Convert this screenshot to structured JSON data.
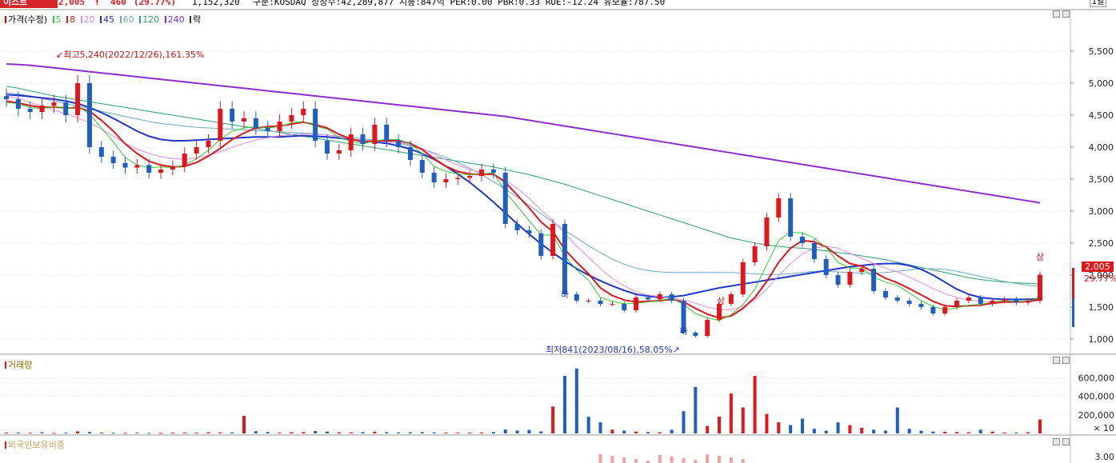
{
  "header": {
    "stock_name": "이스트",
    "price": "2,005",
    "change_arrow": "↑",
    "change": "460",
    "change_pct": "(29.77%)",
    "volume": "1,152,320",
    "info": "구분:KOSDAQ  상장수:42,289,877  시총:847억  PER:0.00  PBR:0.33  ROE:-12.24  유보율:787.50",
    "period": "1일"
  },
  "legend": {
    "items": [
      {
        "label": "가격(수정)",
        "color": "#cc0000"
      },
      {
        "label": "5",
        "color": "#33cc33"
      },
      {
        "label": "8",
        "color": "#e0161d"
      },
      {
        "label": "20",
        "color": "#e68be6"
      },
      {
        "label": "45",
        "color": "#1f37c8"
      },
      {
        "label": "60",
        "color": "#6fa8c6"
      },
      {
        "label": "120",
        "color": "#2e9e6a"
      },
      {
        "label": "240",
        "color": "#8a2fc9"
      },
      {
        "label": "락",
        "color": "#333333"
      }
    ]
  },
  "annotations": {
    "high": "최고5,240(2022/12/26),161.35%",
    "low": "최저841(2023/08/16),58.05%",
    "limit_up": "상",
    "limit_down": "하"
  },
  "current_price_label": "2,005",
  "current_pct_label": "29.77%",
  "volume_panel": {
    "label": "거래량",
    "unit": "× 10"
  },
  "foreign_panel": {
    "label": "외국인보유비중"
  },
  "colors": {
    "up": "#e0161d",
    "down": "#1f5fbf",
    "background": "#ffffff",
    "grid": "#e6e6e6"
  },
  "chart_data": [
    {
      "type": "line",
      "title": "가격(수정)",
      "ylim": [
        800,
        5900
      ],
      "ticks": [
        1000,
        1500,
        2000,
        2500,
        3000,
        3500,
        4000,
        4500,
        5000,
        5500
      ],
      "tick_labels": [
        "1,000",
        "1,500",
        "2,000",
        "2,500",
        "3,000",
        "3,500",
        "4,000",
        "4,500",
        "5,000",
        "5,500"
      ],
      "close": [
        4750,
        4600,
        4550,
        4650,
        4700,
        4500,
        5000,
        4000,
        3850,
        3750,
        3680,
        3720,
        3600,
        3650,
        3700,
        3900,
        4000,
        4100,
        4600,
        4400,
        4450,
        4300,
        4250,
        4400,
        4500,
        4600,
        4100,
        3900,
        3950,
        4200,
        4050,
        4350,
        4100,
        4000,
        3800,
        3600,
        3450,
        3500,
        3520,
        3550,
        3650,
        3600,
        2800,
        2700,
        2650,
        2300,
        2800,
        1700,
        1600,
        1600,
        1550,
        1550,
        1450,
        1650,
        1620,
        1700,
        1600,
        1100,
        1050,
        1300,
        1550,
        1700,
        2200,
        2450,
        2900,
        3200,
        2600,
        2500,
        2250,
        2000,
        1850,
        2050,
        2100,
        1750,
        1650,
        1600,
        1550,
        1500,
        1400,
        1500,
        1600,
        1650,
        1550,
        1600,
        1620,
        1570,
        1600,
        2005
      ],
      "series": [
        {
          "name": "5",
          "values": [
            4700,
            4680,
            4620,
            4600,
            4640,
            4600,
            4640,
            4520,
            4300,
            4080,
            3840,
            3720,
            3680,
            3690,
            3680,
            3720,
            3820,
            3950,
            4120,
            4250,
            4300,
            4320,
            4300,
            4320,
            4380,
            4400,
            4330,
            4280,
            4150,
            4090,
            4050,
            4100,
            4120,
            4120,
            4050,
            3900,
            3700,
            3620,
            3580,
            3570,
            3580,
            3600,
            3300,
            3080,
            2850,
            2630,
            2620,
            2300,
            2080,
            1920,
            1650,
            1590,
            1550,
            1560,
            1580,
            1600,
            1640,
            1540,
            1400,
            1330,
            1290,
            1380,
            1540,
            1780,
            2160,
            2540,
            2670,
            2660,
            2580,
            2430,
            2200,
            2110,
            2110,
            1970,
            1890,
            1840,
            1720,
            1600,
            1510,
            1460,
            1490,
            1530,
            1540,
            1580,
            1600,
            1590,
            1590,
            1650
          ]
        },
        {
          "name": "8",
          "values": [
            4720,
            4690,
            4650,
            4620,
            4630,
            4610,
            4620,
            4560,
            4420,
            4250,
            4050,
            3900,
            3780,
            3720,
            3690,
            3700,
            3760,
            3860,
            3980,
            4120,
            4220,
            4300,
            4320,
            4330,
            4360,
            4390,
            4350,
            4300,
            4200,
            4130,
            4080,
            4100,
            4100,
            4100,
            4060,
            3960,
            3820,
            3700,
            3620,
            3580,
            3570,
            3580,
            3450,
            3250,
            3050,
            2830,
            2680,
            2400,
            2200,
            2020,
            1800,
            1680,
            1610,
            1580,
            1590,
            1600,
            1620,
            1580,
            1480,
            1390,
            1330,
            1360,
            1480,
            1650,
            1900,
            2200,
            2420,
            2540,
            2520,
            2440,
            2300,
            2180,
            2140,
            2050,
            1950,
            1880,
            1790,
            1690,
            1590,
            1520,
            1510,
            1520,
            1530,
            1560,
            1580,
            1580,
            1585,
            1620
          ]
        },
        {
          "name": "20",
          "values": [
            4800,
            4760,
            4700,
            4640,
            4580,
            4520,
            4460,
            4380,
            4280,
            4170,
            4060,
            3970,
            3900,
            3850,
            3820,
            3810,
            3830,
            3870,
            3930,
            4000,
            4060,
            4110,
            4150,
            4180,
            4200,
            4210,
            4200,
            4190,
            4160,
            4130,
            4100,
            4090,
            4080,
            4070,
            4040,
            3980,
            3890,
            3800,
            3720,
            3650,
            3600,
            3560,
            3480,
            3360,
            3200,
            3020,
            2850,
            2650,
            2450,
            2280,
            2100,
            1950,
            1830,
            1740,
            1690,
            1660,
            1640,
            1610,
            1560,
            1500,
            1460,
            1460,
            1510,
            1610,
            1780,
            1990,
            2180,
            2330,
            2420,
            2450,
            2420,
            2340,
            2260,
            2180,
            2110,
            2050,
            1970,
            1880,
            1790,
            1710,
            1650,
            1610,
            1590,
            1580,
            1580,
            1580,
            1580,
            1600
          ]
        },
        {
          "name": "45",
          "values": [
            4820,
            4810,
            4790,
            4770,
            4750,
            4720,
            4680,
            4620,
            4540,
            4450,
            4350,
            4250,
            4170,
            4120,
            4100,
            4100,
            4110,
            4120,
            4130,
            4140,
            4150,
            4160,
            4160,
            4160,
            4170,
            4180,
            4170,
            4160,
            4140,
            4120,
            4100,
            4080,
            4060,
            4020,
            3970,
            3900,
            3810,
            3700,
            3580,
            3450,
            3300,
            3140,
            2970,
            2800,
            2640,
            2490,
            2350,
            2220,
            2100,
            2000,
            1910,
            1830,
            1760,
            1700,
            1670,
            1650,
            1660,
            1680,
            1720,
            1760,
            1800,
            1830,
            1860,
            1890,
            1920,
            1950,
            1980,
            2010,
            2040,
            2070,
            2100,
            2130,
            2150,
            2170,
            2180,
            2180,
            2150,
            2090,
            2000,
            1890,
            1780,
            1700,
            1650,
            1630,
            1620,
            1620,
            1620,
            1630
          ]
        },
        {
          "name": "60",
          "values": [
            4850,
            4830,
            4800,
            4760,
            4720,
            4680,
            4640,
            4600,
            4560,
            4520,
            4480,
            4440,
            4400,
            4370,
            4350,
            4330,
            4310,
            4300,
            4290,
            4280,
            4270,
            4260,
            4250,
            4240,
            4230,
            4220,
            4210,
            4190,
            4170,
            4150,
            4130,
            4110,
            4090,
            4060,
            4020,
            3970,
            3910,
            3840,
            3760,
            3670,
            3570,
            3460,
            3340,
            3220,
            3090,
            2960,
            2830,
            2700,
            2580,
            2460,
            2350,
            2250,
            2170,
            2110,
            2070,
            2050,
            2040,
            2040,
            2040,
            2040,
            2040,
            2040,
            2030,
            2020,
            2010,
            2010,
            2020,
            2040,
            2060,
            2060,
            2050,
            2040,
            2030,
            2030,
            2040,
            2060,
            2080,
            2100,
            2100,
            2090,
            2060,
            2020,
            1980,
            1940,
            1900,
            1870,
            1840,
            1820
          ]
        },
        {
          "name": "120",
          "values": [
            4950,
            4920,
            4880,
            4840,
            4800,
            4770,
            4740,
            4710,
            4680,
            4650,
            4620,
            4590,
            4560,
            4530,
            4500,
            4470,
            4440,
            4410,
            4380,
            4350,
            4320,
            4290,
            4260,
            4230,
            4200,
            4170,
            4140,
            4110,
            4080,
            4050,
            4020,
            3990,
            3960,
            3930,
            3900,
            3870,
            3840,
            3810,
            3780,
            3750,
            3720,
            3690,
            3650,
            3610,
            3570,
            3520,
            3470,
            3420,
            3360,
            3300,
            3240,
            3180,
            3120,
            3060,
            3000,
            2940,
            2880,
            2820,
            2760,
            2700,
            2640,
            2580,
            2540,
            2500,
            2470,
            2450,
            2430,
            2420,
            2400,
            2380,
            2350,
            2330,
            2300,
            2270,
            2240,
            2200,
            2160,
            2120,
            2080,
            2040,
            2000,
            1960,
            1930,
            1910,
            1890,
            1880,
            1870,
            1860
          ]
        },
        {
          "name": "240",
          "values": [
            5300,
            5290,
            5280,
            5260,
            5240,
            5220,
            5200,
            5180,
            5160,
            5140,
            5120,
            5100,
            5080,
            5060,
            5040,
            5020,
            5000,
            4980,
            4960,
            4940,
            4920,
            4900,
            4880,
            4860,
            4840,
            4820,
            4800,
            4780,
            4760,
            4740,
            4720,
            4700,
            4680,
            4660,
            4640,
            4620,
            4600,
            4580,
            4560,
            4540,
            4520,
            4500,
            4480,
            4450,
            4420,
            4390,
            4360,
            4330,
            4300,
            4270,
            4240,
            4210,
            4180,
            4150,
            4120,
            4090,
            4060,
            4030,
            4000,
            3970,
            3940,
            3910,
            3880,
            3850,
            3820,
            3790,
            3760,
            3730,
            3700,
            3670,
            3640,
            3610,
            3580,
            3550,
            3520,
            3490,
            3460,
            3430,
            3400,
            3370,
            3340,
            3310,
            3280,
            3250,
            3220,
            3190,
            3160,
            3130
          ]
        }
      ]
    },
    {
      "type": "bar",
      "title": "거래량",
      "ylim": [
        0,
        750000
      ],
      "ticks": [
        200000,
        400000,
        600000
      ],
      "tick_labels": [
        "200,000",
        "400,000",
        "600,000"
      ],
      "values": [
        8000,
        9000,
        7000,
        12000,
        6000,
        8000,
        22000,
        15000,
        9000,
        7000,
        6000,
        8000,
        5000,
        6000,
        7000,
        9000,
        8000,
        12000,
        10000,
        11000,
        190000,
        24000,
        15000,
        9000,
        12000,
        14000,
        26000,
        20000,
        12000,
        11000,
        14000,
        19000,
        13000,
        10000,
        12000,
        14000,
        11000,
        9000,
        8000,
        9000,
        10000,
        15000,
        42000,
        31000,
        38000,
        22000,
        290000,
        620000,
        700000,
        180000,
        120000,
        40000,
        30000,
        20000,
        15000,
        12000,
        40000,
        240000,
        500000,
        80000,
        180000,
        430000,
        280000,
        620000,
        210000,
        120000,
        90000,
        160000,
        50000,
        30000,
        120000,
        90000,
        60000,
        40000,
        30000,
        280000,
        50000,
        30000,
        20000,
        18000,
        15000,
        12000,
        40000,
        20000,
        10000,
        9000,
        12000,
        150000
      ],
      "up": [
        1,
        0,
        1,
        0,
        1,
        0,
        1,
        0,
        0,
        0,
        1,
        0,
        0,
        1,
        1,
        1,
        1,
        1,
        1,
        0,
        1,
        0,
        0,
        1,
        1,
        1,
        0,
        0,
        1,
        1,
        0,
        1,
        0,
        0,
        0,
        0,
        0,
        1,
        1,
        1,
        1,
        0,
        0,
        0,
        0,
        0,
        1,
        0,
        0,
        0,
        0,
        1,
        0,
        1,
        0,
        1,
        0,
        0,
        0,
        1,
        1,
        1,
        1,
        1,
        1,
        1,
        0,
        0,
        0,
        0,
        0,
        1,
        1,
        0,
        0,
        0,
        0,
        0,
        0,
        1,
        1,
        1,
        0,
        1,
        1,
        0,
        1,
        1
      ]
    }
  ]
}
